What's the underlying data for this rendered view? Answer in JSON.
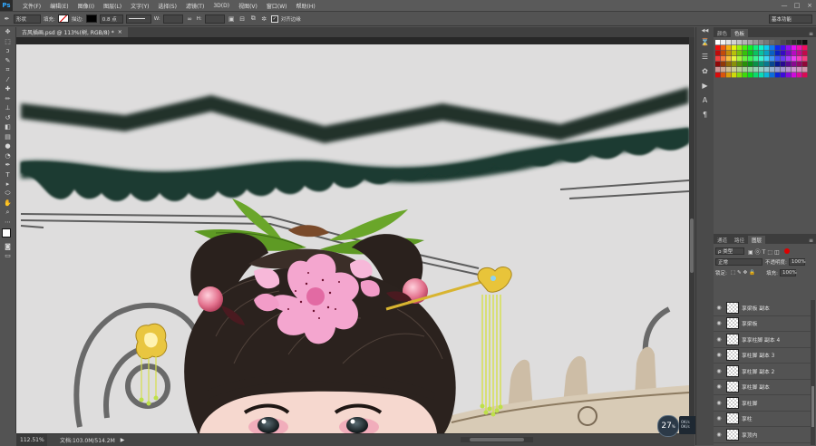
{
  "app": {
    "logo": "Ps"
  },
  "menu": [
    "文件(F)",
    "编辑(E)",
    "图像(I)",
    "图层(L)",
    "文字(Y)",
    "选择(S)",
    "滤镜(T)",
    "3D(D)",
    "视图(V)",
    "窗口(W)",
    "帮助(H)"
  ],
  "window_controls": [
    "—",
    "□",
    "×"
  ],
  "options": {
    "shape_mode": "形状",
    "fill_label": "填充:",
    "stroke_label": "描边:",
    "stroke_width": "0.8 点",
    "w_label": "W:",
    "h_label": "H:",
    "align_edges": "对齐边缘",
    "workspace": "基本功能"
  },
  "document": {
    "tab_label": "古风插画.psd @ 113%(树, RGB/8) *",
    "close": "×"
  },
  "status": {
    "zoom": "112.51%",
    "doc_size": "文档:103.0M/514.2M",
    "arrow": "▶"
  },
  "navigator": {
    "value": "27",
    "unit": "%",
    "stat1": "0K/s",
    "stat2": "0K/s"
  },
  "swatches_panel": {
    "tabs": [
      "颜色",
      "色板"
    ],
    "active": 1
  },
  "layers_panel": {
    "tabs": [
      "通道",
      "路径",
      "图层"
    ],
    "active": 2,
    "filter_kind": "ρ 类型",
    "blend_mode": "正常",
    "opacity_label": "不透明度:",
    "opacity_value": "100%",
    "lock_label": "锁定:",
    "fill_label": "填充:",
    "fill_value": "100%",
    "layers": [
      {
        "name": "享梁板 副本"
      },
      {
        "name": "享梁板"
      },
      {
        "name": "享享柱脚 副本 4"
      },
      {
        "name": "享柱脚 副本 3"
      },
      {
        "name": "享柱脚 副本 2"
      },
      {
        "name": "享柱脚 副本"
      },
      {
        "name": "享柱脚"
      },
      {
        "name": "享柱"
      },
      {
        "name": "享顶内"
      }
    ]
  }
}
